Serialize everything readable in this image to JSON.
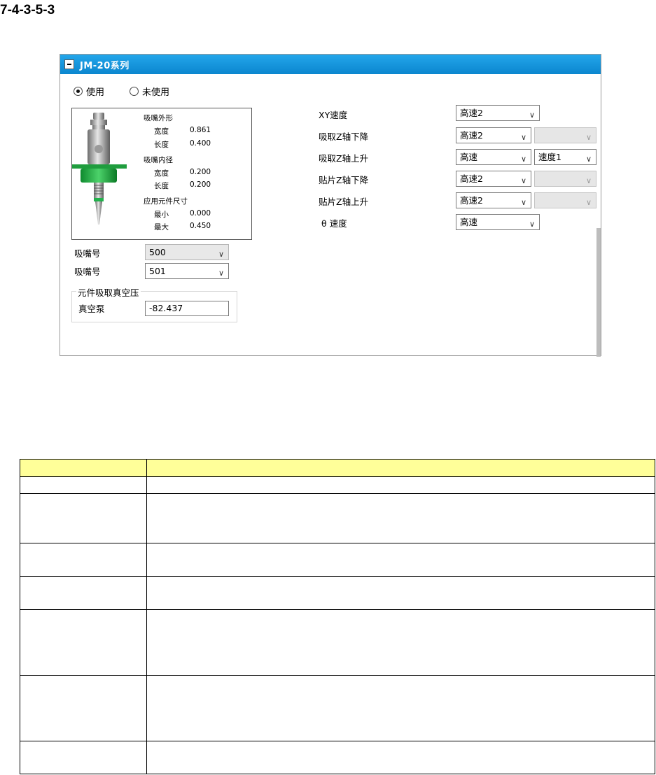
{
  "section_heading": "7-4-3-5-3",
  "panel": {
    "title": "JM-20系列",
    "radio_use": "使用",
    "radio_unused": "未使用",
    "selected": "use",
    "nozzle_specs": {
      "outer_label": "吸嘴外形",
      "width_label": "宽度",
      "outer_width": "0.861",
      "length_label": "长度",
      "outer_length": "0.400",
      "inner_label": "吸嘴内径",
      "inner_width": "0.200",
      "inner_length": "0.200",
      "component_label": "应用元件尺寸",
      "min_label": "最小",
      "min_value": "0.000",
      "max_label": "最大",
      "max_value": "0.450"
    },
    "nozzle_rows": [
      {
        "label": "吸嘴号",
        "value": "500"
      },
      {
        "label": "吸嘴号",
        "value": "501"
      }
    ],
    "vacuum_group": {
      "legend": "元件吸取真空压",
      "label": "真空泵",
      "value": "-82.437"
    },
    "speeds": [
      {
        "label": "XY速度",
        "value": "高速2"
      },
      {
        "label": "吸取Z轴下降",
        "value": "高速2",
        "secondary": ""
      },
      {
        "label": "吸取Z轴上升",
        "value": "高速",
        "secondary": "速度1"
      },
      {
        "label": "贴片Z轴下降",
        "value": "高速2",
        "secondary": ""
      },
      {
        "label": "贴片Z轴上升",
        "value": "高速2",
        "secondary": ""
      },
      {
        "label": "θ 速度",
        "value": "高速"
      }
    ],
    "colors": {
      "titlebar": "#0b86cf",
      "nozzle_green": "#22b14c",
      "header_yellow": "#ffff99"
    }
  }
}
